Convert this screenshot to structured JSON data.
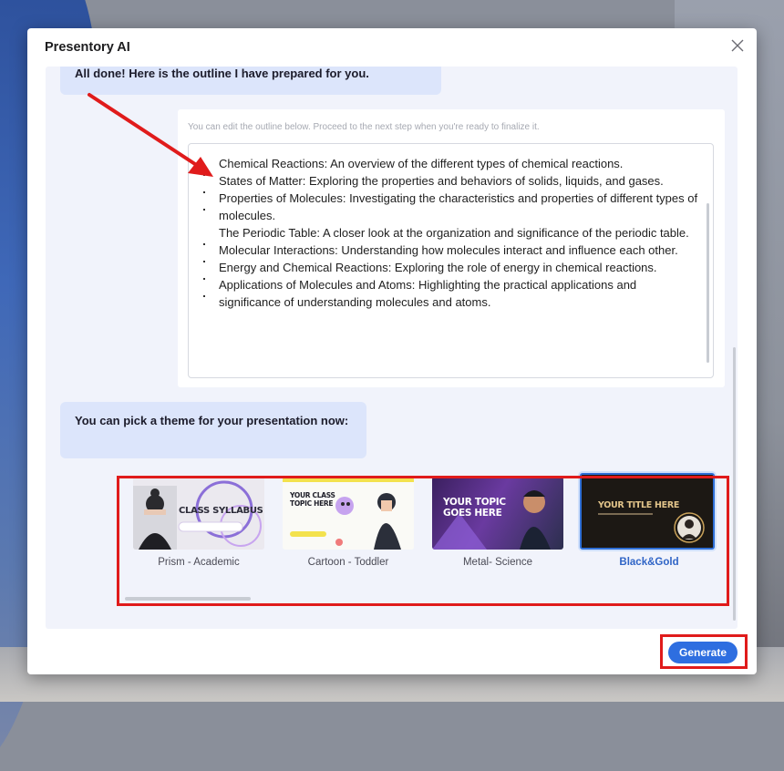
{
  "dialog": {
    "title": "Presentory AI",
    "close_icon": "close-icon"
  },
  "chat": {
    "message_done": "All done! Here is the outline I have prepared for you.",
    "outline_hint": "You can edit the outline below. Proceed to the next step when you're ready to finalize it.",
    "outline_items": [
      "Chemical Reactions: An overview of the different types of chemical reactions.",
      "States of Matter: Exploring the properties and behaviors of solids, liquids, and gases.",
      "Properties of Molecules: Investigating the characteristics and properties of different types of molecules.",
      "The Periodic Table: A closer look at the organization and significance of the periodic table.",
      "Molecular Interactions: Understanding how molecules interact and influence each other.",
      "Energy and Chemical Reactions: Exploring the role of energy in chemical reactions.",
      "Applications of Molecules and Atoms: Highlighting the practical applications and significance of understanding molecules and atoms."
    ],
    "message_theme": "You can pick a theme for your presentation now:"
  },
  "themes": [
    {
      "label": "Prism - Academic",
      "thumb_title": "CLASS SYLLABUS",
      "selected": false
    },
    {
      "label": "Cartoon - Toddler",
      "thumb_title": "YOUR CLASS TOPIC HERE",
      "selected": false
    },
    {
      "label": "Metal- Science",
      "thumb_title": "YOUR TOPIC GOES HERE",
      "selected": false
    },
    {
      "label": "Black&Gold",
      "thumb_title": "YOUR TITLE HERE",
      "selected": true
    }
  ],
  "footer": {
    "generate_label": "Generate"
  },
  "colors": {
    "accent": "#2e6ee0",
    "annotation_red": "#e01b1b",
    "bubble": "#dce5fb"
  }
}
